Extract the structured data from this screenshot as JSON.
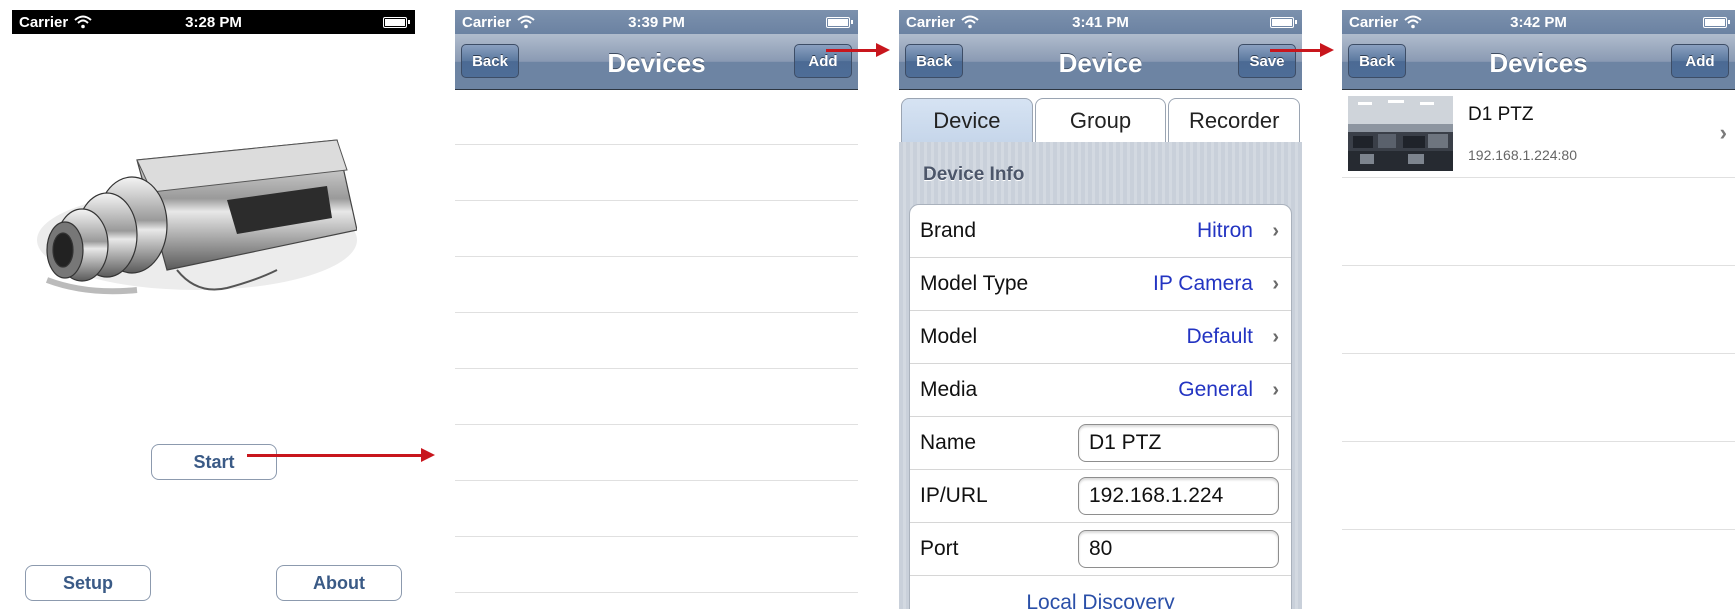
{
  "screen1": {
    "status": {
      "carrier": "Carrier",
      "time": "3:28 PM"
    },
    "start_label": "Start",
    "setup_label": "Setup",
    "about_label": "About"
  },
  "screen2": {
    "status": {
      "carrier": "Carrier",
      "time": "3:39 PM"
    },
    "nav": {
      "back": "Back",
      "title": "Devices",
      "right": "Add"
    },
    "rows": 9
  },
  "screen3": {
    "status": {
      "carrier": "Carrier",
      "time": "3:41 PM"
    },
    "nav": {
      "back": "Back",
      "title": "Device",
      "right": "Save"
    },
    "tabs": [
      "Device",
      "Group",
      "Recorder"
    ],
    "active_tab": "Device",
    "section_title": "Device Info",
    "rows": [
      {
        "label": "Brand",
        "value": "Hitron"
      },
      {
        "label": "Model Type",
        "value": "IP Camera"
      },
      {
        "label": "Model",
        "value": "Default"
      },
      {
        "label": "Media",
        "value": "General"
      }
    ],
    "fields": [
      {
        "label": "Name",
        "value": "D1 PTZ"
      },
      {
        "label": "IP/URL",
        "value": "192.168.1.224"
      },
      {
        "label": "Port",
        "value": "80"
      }
    ],
    "action": "Local Discovery"
  },
  "screen4": {
    "status": {
      "carrier": "Carrier",
      "time": "3:42 PM"
    },
    "nav": {
      "back": "Back",
      "title": "Devices",
      "right": "Add"
    },
    "device": {
      "name": "D1 PTZ",
      "address": "192.168.1.224:80"
    }
  },
  "colors": {
    "accent_link": "#2334c2",
    "arrow": "#c8161d",
    "navbar": "#6d84a3"
  }
}
